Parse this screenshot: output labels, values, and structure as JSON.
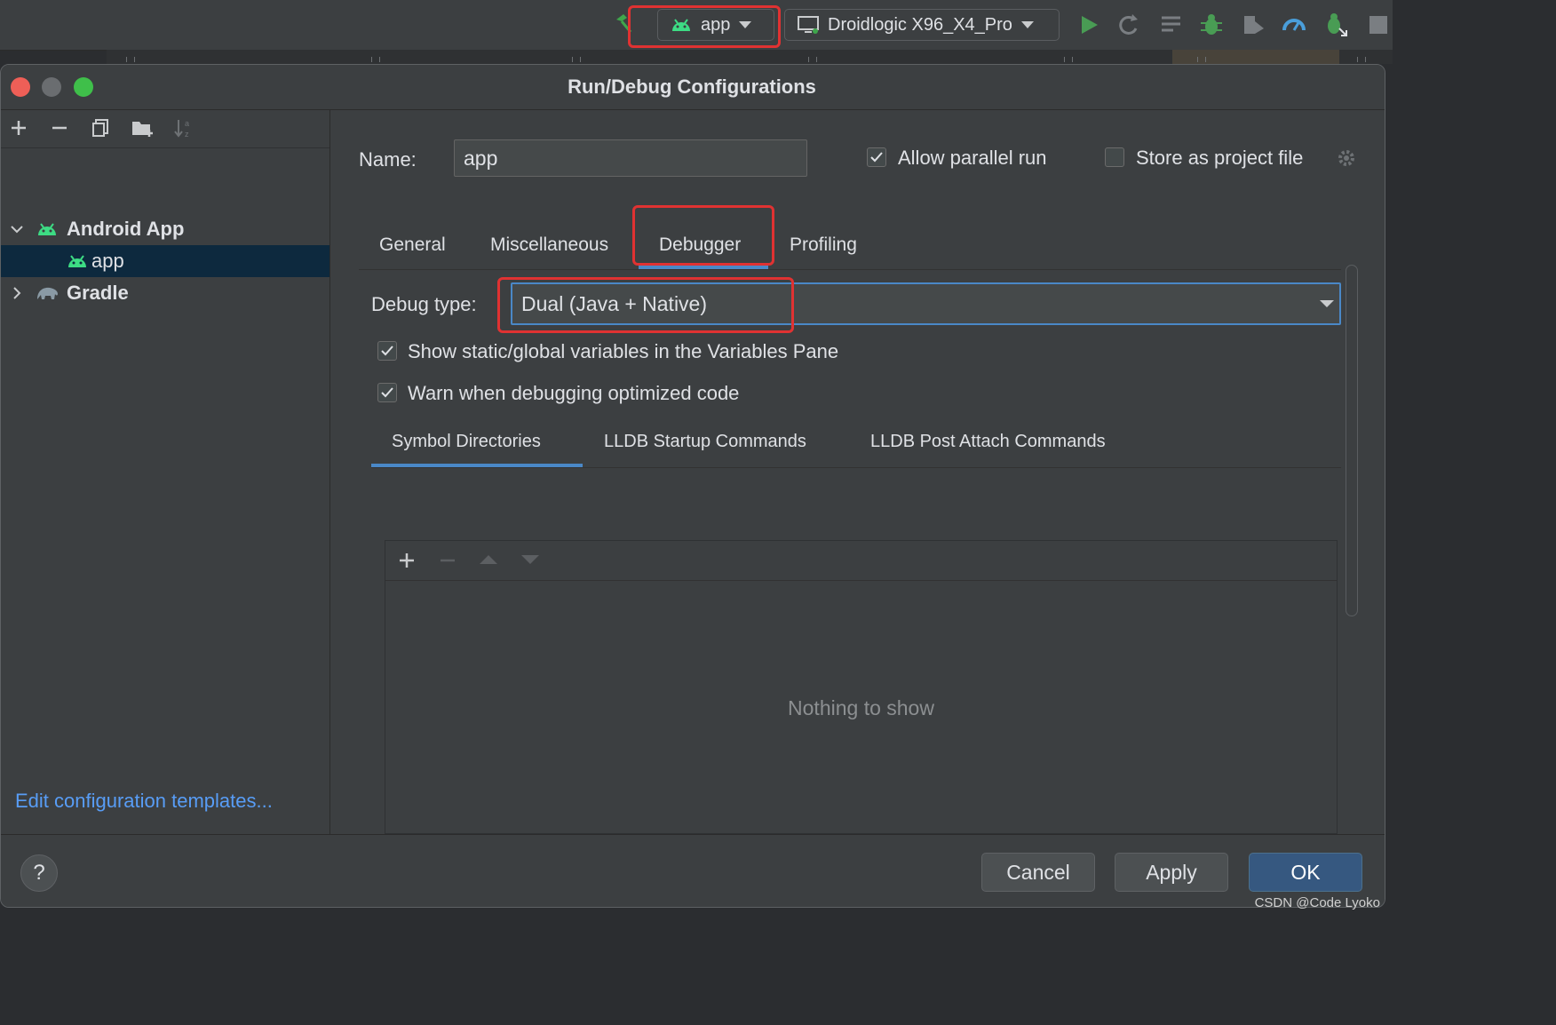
{
  "ide_toolbar": {
    "run_config": "app",
    "device": "Droidlogic X96_X4_Pro"
  },
  "dialog": {
    "title": "Run/Debug Configurations",
    "tree": {
      "group_android": "Android App",
      "item_app": "app",
      "group_gradle": "Gradle"
    },
    "edit_templates_link": "Edit configuration templates...",
    "name_label": "Name:",
    "name_value": "app",
    "allow_parallel_label": "Allow parallel run",
    "allow_parallel_checked": true,
    "store_project_label": "Store as project file",
    "store_project_checked": false,
    "tabs": [
      "General",
      "Miscellaneous",
      "Debugger",
      "Profiling"
    ],
    "active_tab": "Debugger",
    "debug_type_label": "Debug type:",
    "debug_type_value": "Dual (Java + Native)",
    "options": [
      {
        "label": "Show static/global variables in the Variables Pane",
        "checked": true
      },
      {
        "label": "Warn when debugging optimized code",
        "checked": true
      }
    ],
    "subtabs": [
      "Symbol Directories",
      "LLDB Startup Commands",
      "LLDB Post Attach Commands"
    ],
    "active_subtab": "Symbol Directories",
    "empty_text": "Nothing to show",
    "buttons": {
      "cancel": "Cancel",
      "apply": "Apply",
      "ok": "OK",
      "help": "?"
    }
  },
  "watermark": "CSDN @Code Lyoko",
  "colors": {
    "accent": "#4a88c7",
    "highlight_box": "#e03232",
    "android_green": "#3ddc84",
    "link": "#589df6"
  }
}
